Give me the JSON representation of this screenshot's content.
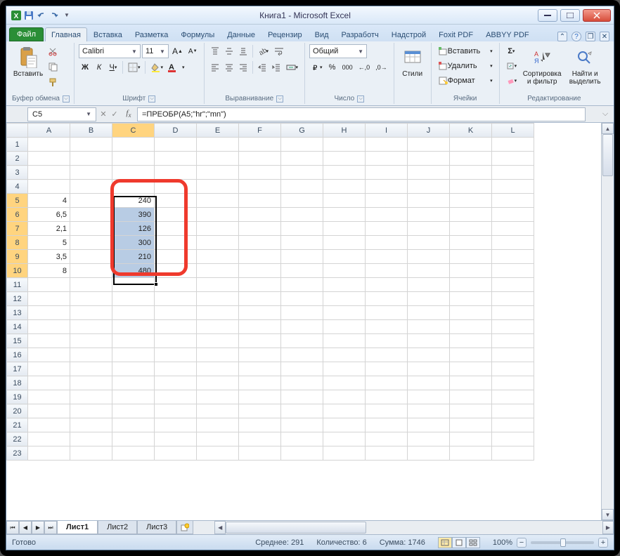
{
  "window": {
    "title": "Книга1  -  Microsoft Excel"
  },
  "qat": [
    "excel",
    "save",
    "undo",
    "redo"
  ],
  "tabs": {
    "file": "Файл",
    "items": [
      "Главная",
      "Вставка",
      "Разметка",
      "Формулы",
      "Данные",
      "Рецензир",
      "Вид",
      "Разработч",
      "Надстрой",
      "Foxit PDF",
      "ABBYY PDF"
    ],
    "active": 0
  },
  "ribbon": {
    "clipboard": {
      "paste": "Вставить",
      "label": "Буфер обмена"
    },
    "font": {
      "name": "Calibri",
      "size": "11",
      "label": "Шрифт"
    },
    "align": {
      "label": "Выравнивание"
    },
    "number": {
      "format": "Общий",
      "label": "Число"
    },
    "styles": {
      "btn": "Стили",
      "label": ""
    },
    "cells": {
      "insert": "Вставить",
      "delete": "Удалить",
      "format": "Формат",
      "label": "Ячейки"
    },
    "editing": {
      "sort": "Сортировка и фильтр",
      "find": "Найти и выделить",
      "label": "Редактирование"
    }
  },
  "formula_bar": {
    "name": "C5",
    "fx": "=ПРЕОБР(A5;\"hr\";\"mn\")"
  },
  "columns": [
    "A",
    "B",
    "C",
    "D",
    "E",
    "F",
    "G",
    "H",
    "I",
    "J",
    "K",
    "L"
  ],
  "rows": [
    1,
    2,
    3,
    4,
    5,
    6,
    7,
    8,
    9,
    10,
    11,
    12,
    13,
    14,
    15,
    16,
    17,
    18,
    19,
    20,
    21,
    22,
    23
  ],
  "data": {
    "A": {
      "5": "4",
      "6": "6,5",
      "7": "2,1",
      "8": "5",
      "9": "3,5",
      "10": "8"
    },
    "C": {
      "5": "240",
      "6": "390",
      "7": "126",
      "8": "300",
      "9": "210",
      "10": "480"
    }
  },
  "selection": {
    "col": "C",
    "rows": [
      5,
      6,
      7,
      8,
      9,
      10
    ],
    "active_row": 5
  },
  "sheet_tabs": {
    "tabs": [
      "Лист1",
      "Лист2",
      "Лист3"
    ],
    "active": 0
  },
  "status": {
    "ready": "Готово",
    "avg_label": "Среднее:",
    "avg": "291",
    "count_label": "Количество:",
    "count": "6",
    "sum_label": "Сумма:",
    "sum": "1746",
    "zoom": "100%"
  }
}
